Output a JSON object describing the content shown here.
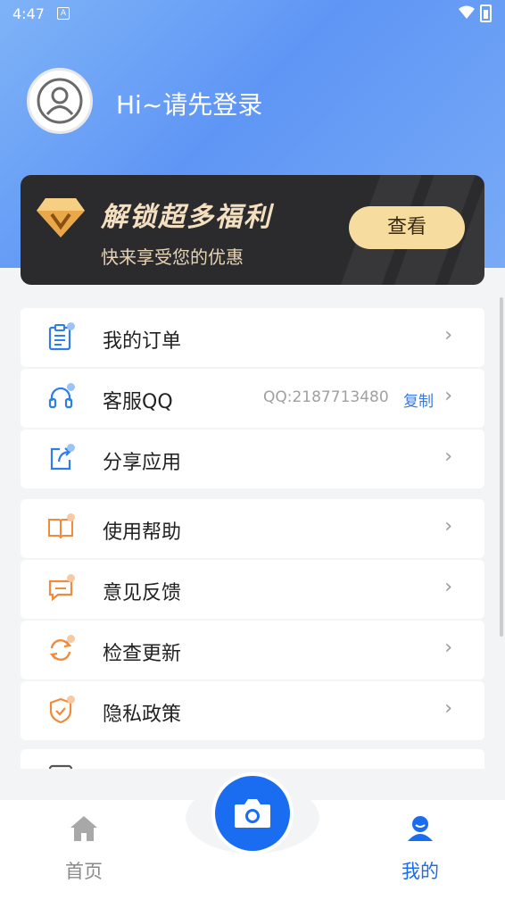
{
  "status_bar": {
    "time": "4:47",
    "a_badge": "A"
  },
  "profile": {
    "login_text": "Hi~请先登录"
  },
  "vip_banner": {
    "title": "解锁超多福利",
    "subtitle": "快来享受您的优惠",
    "button_label": "查看"
  },
  "menu_group_1": [
    {
      "label": "我的订单",
      "icon": "order-clipboard-icon"
    },
    {
      "label": "客服QQ",
      "icon": "headset-icon",
      "qq_value": "QQ:2187713480",
      "copy_label": "复制"
    },
    {
      "label": "分享应用",
      "icon": "share-icon"
    }
  ],
  "menu_group_2": [
    {
      "label": "使用帮助",
      "icon": "help-book-icon"
    },
    {
      "label": "意见反馈",
      "icon": "feedback-chat-icon"
    },
    {
      "label": "检查更新",
      "icon": "refresh-icon"
    },
    {
      "label": "隐私政策",
      "icon": "shield-check-icon"
    }
  ],
  "tab_bar": {
    "home_label": "首页",
    "mine_label": "我的",
    "camera_icon": "camera-icon"
  },
  "colors": {
    "accent": "#1a6cf0",
    "orange_icon": "#f08a3c",
    "blue_icon": "#2f7de8",
    "vip_gold": "#f6dc9e"
  }
}
